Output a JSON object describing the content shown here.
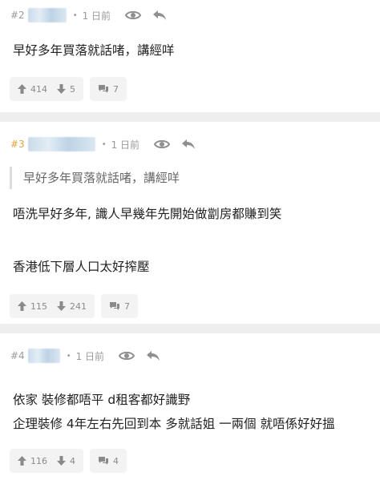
{
  "posts": [
    {
      "floor": "#2",
      "time": "1 日前",
      "lines": [
        "早好多年買落就話啫，講經咩"
      ],
      "up": "414",
      "down": "5",
      "replies": "7"
    },
    {
      "floor": "#3",
      "time": "1 日前",
      "quote": "早好多年買落就話啫，講經咩",
      "lines": [
        "唔洗早好多年, 識人早幾年先開始做劏房都賺到笑",
        "香港低下層人口太好搾壓"
      ],
      "up": "115",
      "down": "241",
      "replies": "7"
    },
    {
      "floor": "#4",
      "time": "1 日前",
      "lines": [
        "依家 裝修都唔平 d租客都好識野",
        "企理裝修 4年左右先回到本 多就話姐 一兩個 就唔係好好搵"
      ],
      "up": "116",
      "down": "4",
      "replies": "4"
    }
  ],
  "icons": {
    "view": "eye-icon",
    "reply": "reply-arrow-icon",
    "up": "thumb-up-arrow-icon",
    "down": "thumb-down-arrow-icon",
    "comment": "speech-bubbles-icon"
  },
  "colors": {
    "op_floor": "#e6a23c",
    "meta": "#9a9a9a",
    "separator": "#eeeeee"
  }
}
